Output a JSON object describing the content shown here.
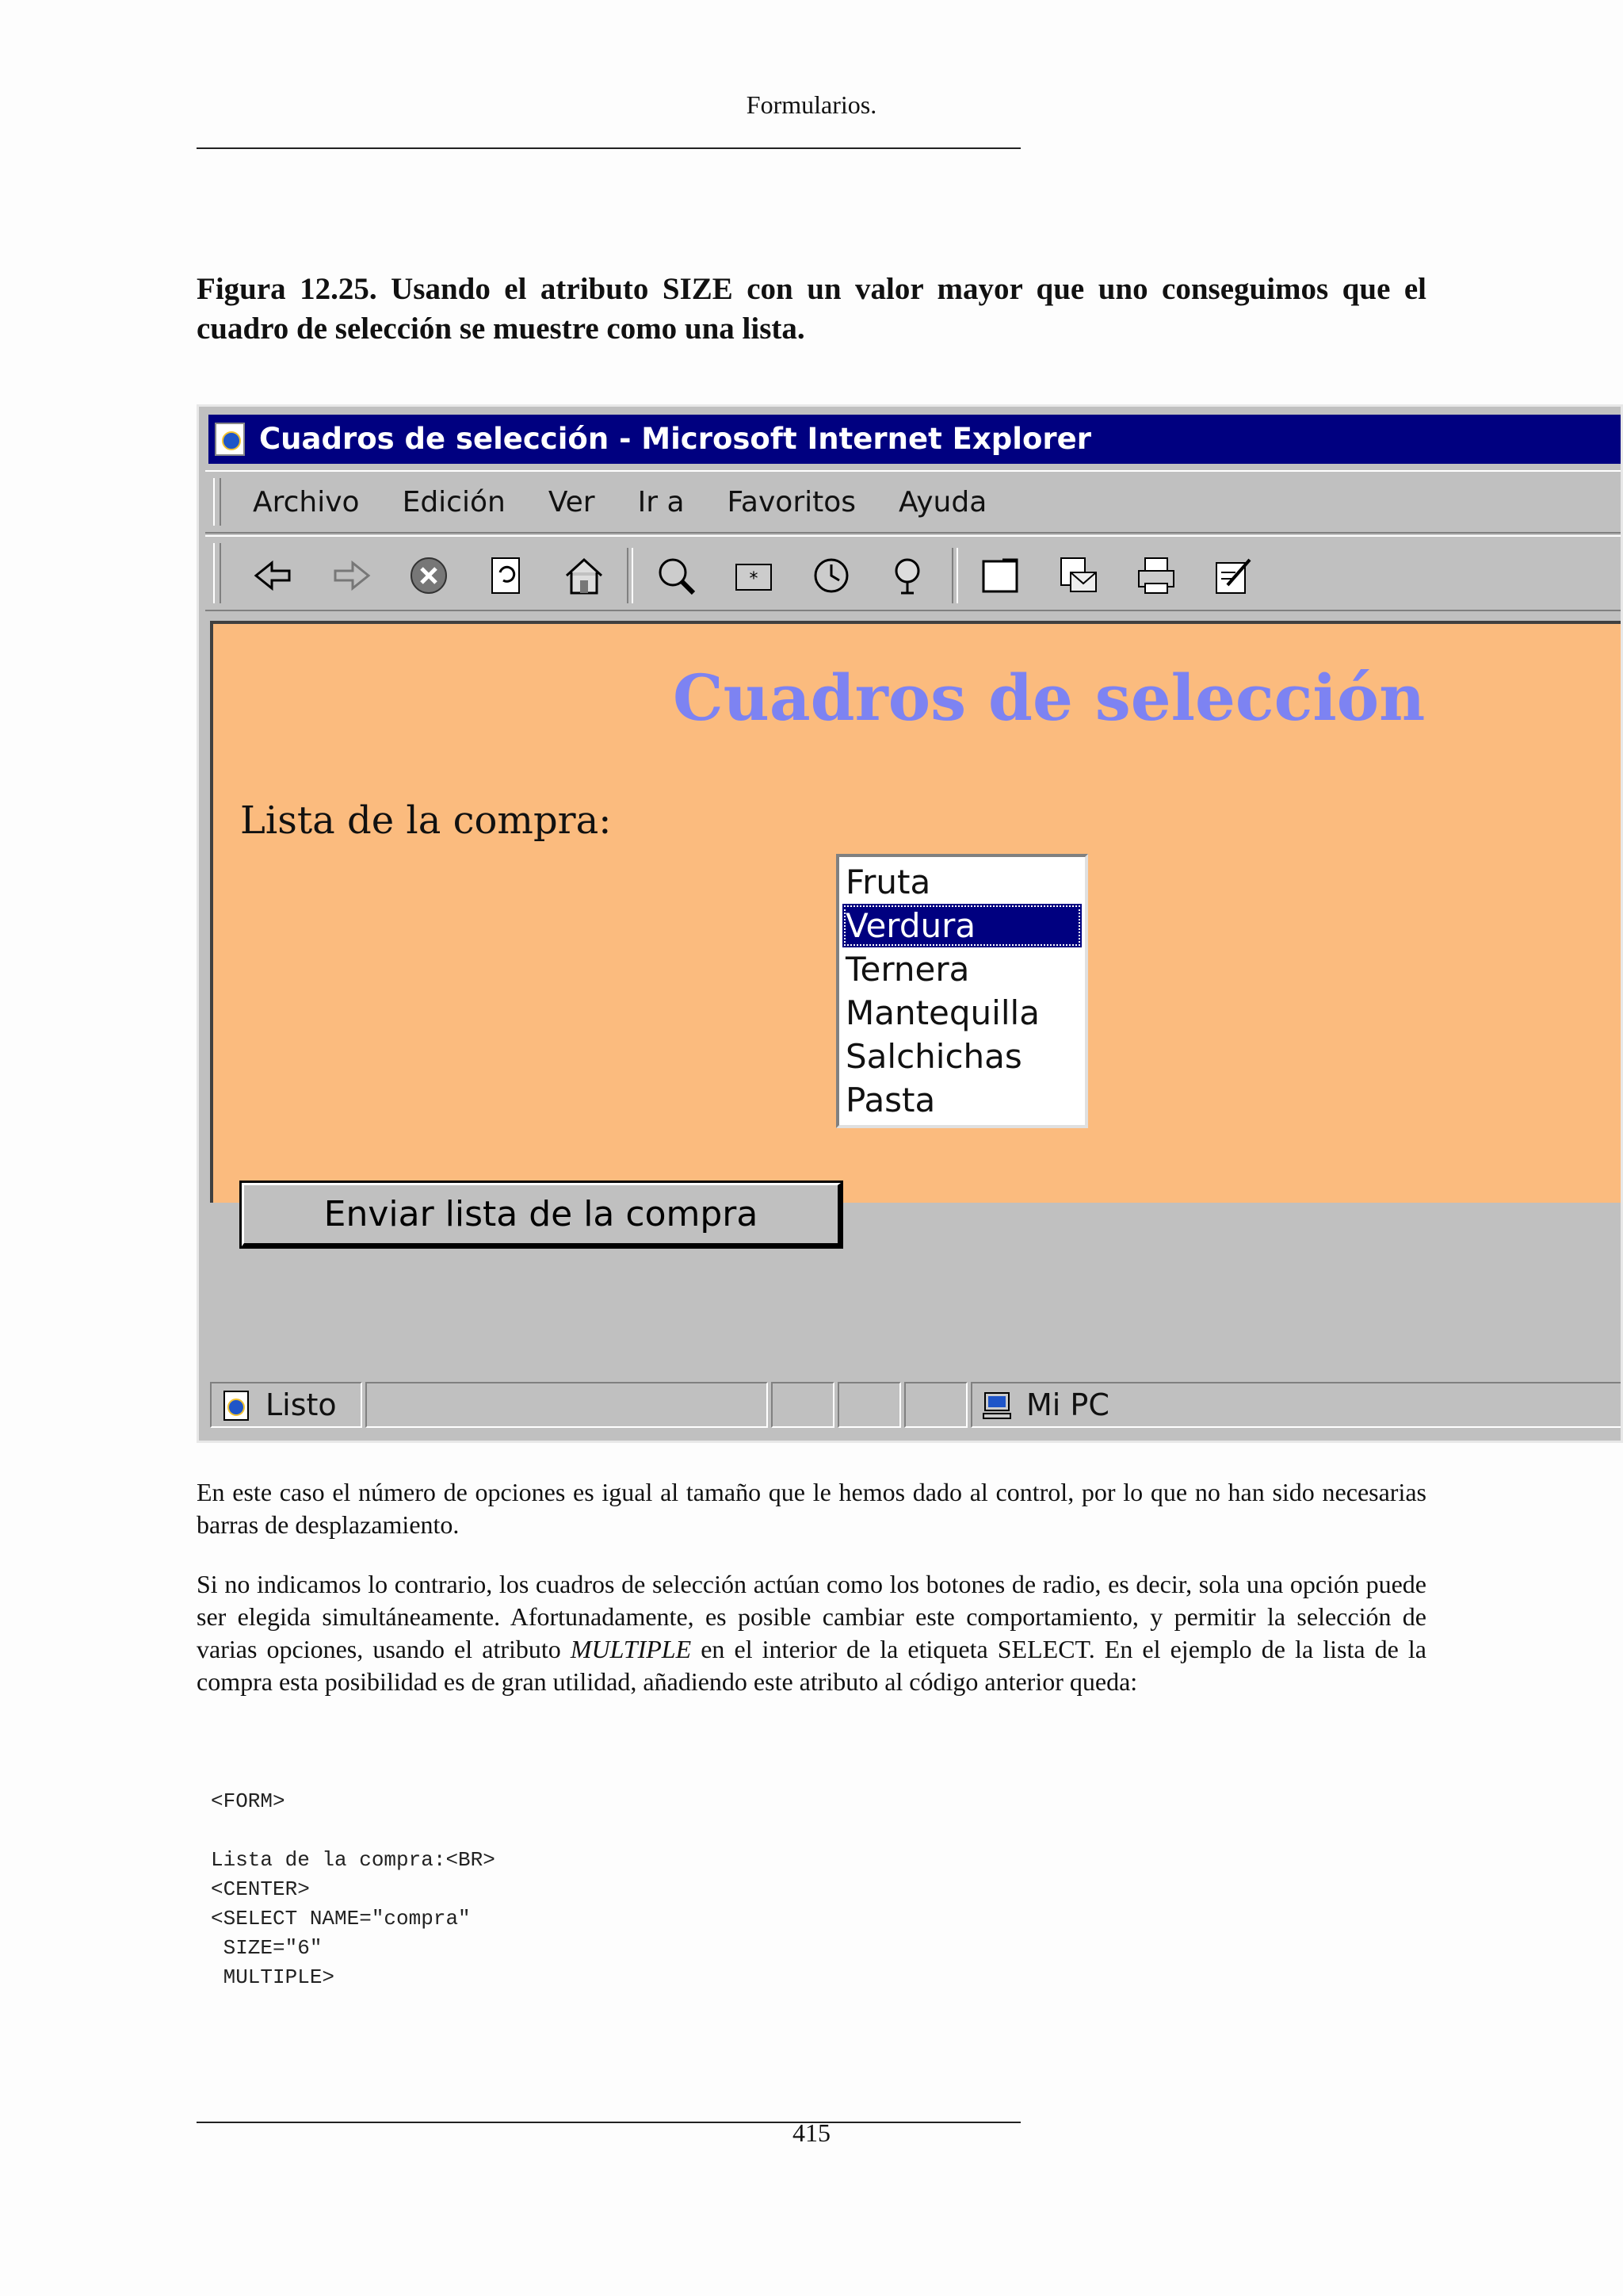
{
  "header": {
    "running_title": "Formularios."
  },
  "caption": "Figura 12.25.  Usando el atributo SIZE con un valor mayor que uno conseguimos que el cuadro de selección se muestre como una lista.",
  "screenshot": {
    "window_title": "Cuadros de selección - Microsoft Internet Explorer",
    "menu": [
      "Archivo",
      "Edición",
      "Ver",
      "Ir a",
      "Favoritos",
      "Ayuda"
    ],
    "toolbar_icons": [
      "back-arrow-icon",
      "forward-arrow-icon",
      "stop-icon",
      "refresh-icon",
      "home-icon",
      "search-icon",
      "favorites-icon",
      "history-icon",
      "channels-icon",
      "fullscreen-icon",
      "mail-icon",
      "print-icon",
      "edit-icon"
    ],
    "page": {
      "heading": "Cuadros de selección",
      "list_label": "Lista de la compra:",
      "options": [
        "Fruta",
        "Verdura",
        "Ternera",
        "Mantequilla",
        "Salchichas",
        "Pasta"
      ],
      "selected_option": "Verdura",
      "submit_label": "Enviar lista de la compra",
      "background_color": "#fbbb7e",
      "heading_color": "#7d83f2"
    },
    "status": {
      "text": "Listo",
      "zone": "Mi PC"
    },
    "colors": {
      "title_bar": "#000080",
      "chrome": "#c0c0c0"
    }
  },
  "body": {
    "para1": "En este caso el número de opciones es igual al tamaño que le hemos dado al control, por lo que no han sido necesarias barras de desplazamiento.",
    "para2_a": "Si no indicamos lo contrario, los cuadros de selección actúan como los botones de radio, es decir, sola una opción puede ser elegida simultáneamente.  Afortunadamente, es posible cambiar este comportamiento, y permitir la selección de varias opciones, usando el atributo ",
    "para2_em": "MULTIPLE",
    "para2_b": " en el interior de la etiqueta SELECT. En el ejemplo de la lista de la compra esta posibilidad es de gran utilidad, añadiendo este atributo al código anterior queda:"
  },
  "code_lines": [
    "<FORM>",
    "",
    "Lista de la compra:<BR>",
    "<CENTER>",
    "<SELECT NAME=\"compra\"",
    " SIZE=\"6\"",
    " MULTIPLE>"
  ],
  "footer": {
    "page_number": "415"
  }
}
